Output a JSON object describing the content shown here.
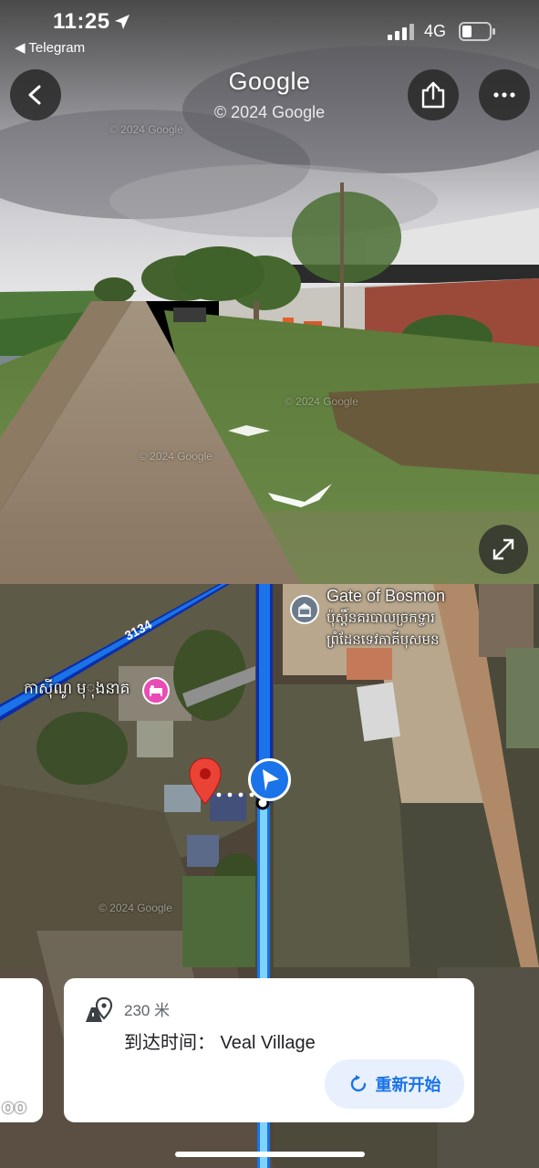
{
  "status": {
    "time": "11:25",
    "back_app": "◀ Telegram",
    "network": "4G"
  },
  "streetview": {
    "title": "Google",
    "copyright": "© 2024 Google",
    "watermarks": [
      "© 2024 Google",
      "© 2024 Google",
      "© 2024 Google"
    ]
  },
  "map": {
    "road_label": "3134",
    "poi_gate": {
      "name": "Gate of Bosmon",
      "khmer_line1": "ប៉ុស្តិ៍នគរបាលច្រកទ្វារ",
      "khmer_line2": "ព្រំដែនទេវភាគីបុសមន"
    },
    "poi_hotel": "កាស៊ីណូ មុុងនាគ",
    "watermark": "© 2024 Google"
  },
  "card": {
    "distance": "230 米",
    "arrival": "到达时间： Veal Village",
    "restart_label": "重新开始",
    "left_card_fragment": "oo"
  },
  "colors": {
    "route_blue": "#1a73e8",
    "pin_red": "#ea4335",
    "hotel_pink": "#e94cb5"
  }
}
